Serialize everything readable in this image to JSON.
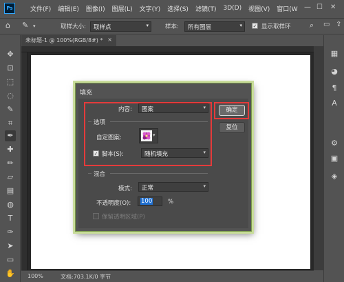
{
  "menubar": {
    "items": [
      "文件(F)",
      "编辑(E)",
      "图像(I)",
      "图层(L)",
      "文字(Y)",
      "选择(S)",
      "滤镜(T)",
      "3D(D)",
      "视图(V)",
      "窗口(W"
    ]
  },
  "options_bar": {
    "sample_size_label": "取样大小:",
    "sample_size_value": "取样点",
    "sample_label": "样本:",
    "sample_value": "所有图层",
    "show_ring_label": "显示取样环"
  },
  "document": {
    "tab_title": "未标题-1 @ 100%(RGB/8#) *"
  },
  "statusbar": {
    "zoom": "100%",
    "doc_info": "文档:703.1K/0 字节"
  },
  "dialog": {
    "title": "填充",
    "contents_label": "内容:",
    "contents_value": "图案",
    "options_group": "选项",
    "custom_pattern_label": "自定图案:",
    "script_label": "脚本(S):",
    "script_value": "随机填充",
    "script_checked": true,
    "blending_group": "混合",
    "mode_label": "模式:",
    "mode_value": "正常",
    "opacity_label": "不透明度(O):",
    "opacity_value": "100",
    "opacity_unit": "%",
    "preserve_label": "保留透明区域(P)",
    "ok_label": "确定",
    "reset_label": "复位"
  },
  "colors": {
    "highlight": "#e53b3b",
    "dialog_border": "#c8dc9a",
    "opacity_selection": "#1f6fd0"
  }
}
